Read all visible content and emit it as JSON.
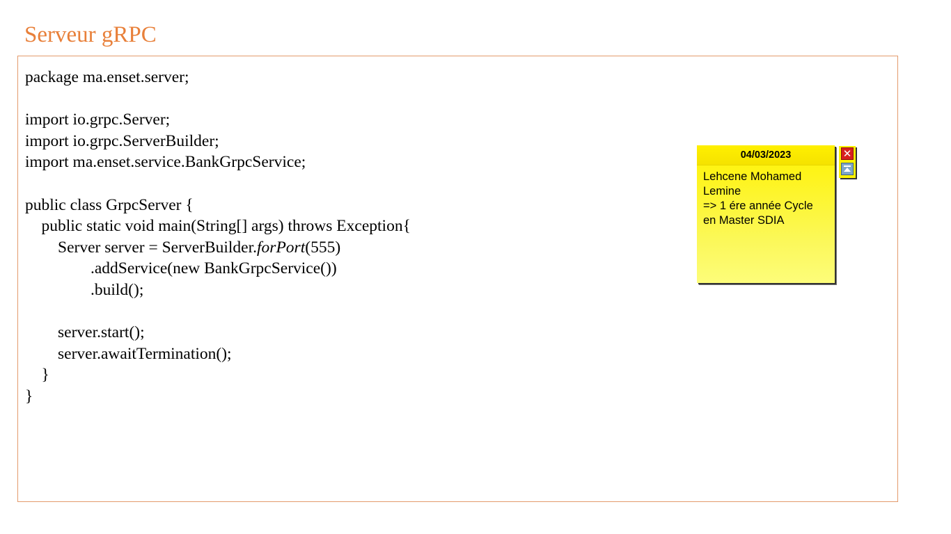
{
  "slide": {
    "title": "Serveur gRPC"
  },
  "code": {
    "lines": [
      {
        "text": "package ma.enset.server;"
      },
      {
        "text": ""
      },
      {
        "text": "import io.grpc.Server;"
      },
      {
        "text": "import io.grpc.ServerBuilder;"
      },
      {
        "text": "import ma.enset.service.BankGrpcService;"
      },
      {
        "text": ""
      },
      {
        "text": "public class GrpcServer {"
      },
      {
        "text": "    public static void main(String[] args) throws Exception{"
      },
      {
        "pre": "        Server server = ServerBuilder.",
        "italic": "forPort",
        "post": "(555)"
      },
      {
        "text": "                .addService(new BankGrpcService())"
      },
      {
        "text": "                .build();"
      },
      {
        "text": ""
      },
      {
        "text": "        server.start();"
      },
      {
        "text": "        server.awaitTermination();"
      },
      {
        "text": "    }"
      },
      {
        "text": "}"
      }
    ]
  },
  "sticky_note": {
    "date": "04/03/2023",
    "lines": [
      "Lehcene Mohamed",
      "Lemine",
      "=> 1 ére année Cycle",
      "en Master SDIA"
    ],
    "close_icon": "close-icon",
    "collapse_icon": "collapse-icon"
  },
  "colors": {
    "title": "#e8803a",
    "border": "#e39a6b",
    "sticky": "#fff200"
  }
}
